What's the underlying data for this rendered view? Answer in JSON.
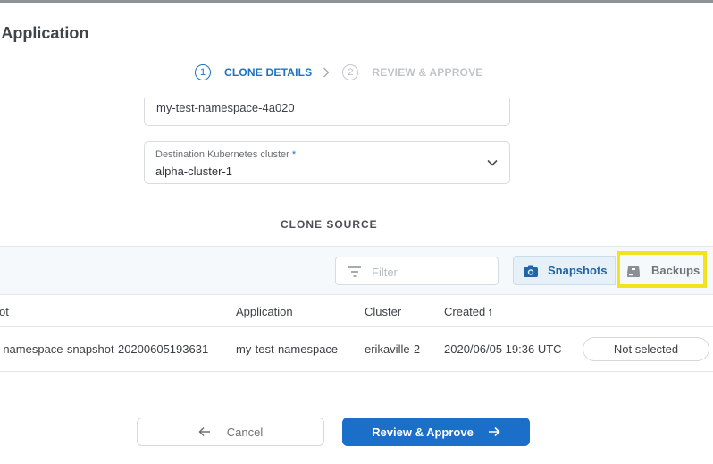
{
  "page": {
    "title": "e Application"
  },
  "stepper": {
    "steps": [
      {
        "number": "1",
        "label": "CLONE DETAILS",
        "active": true
      },
      {
        "number": "2",
        "label": "REVIEW & APPROVE",
        "active": false
      }
    ]
  },
  "form": {
    "namespace_value": "my-test-namespace-4a020",
    "cluster_label": "Destination Kubernetes cluster",
    "cluster_required_mark": "*",
    "cluster_value": "alpha-cluster-1"
  },
  "clone_source": {
    "title": "CLONE SOURCE",
    "filter_placeholder": "Filter",
    "tabs": {
      "snapshots_label": "Snapshots",
      "backups_label": "Backups"
    },
    "columns": [
      "ot",
      "Application",
      "Cluster",
      "Created"
    ],
    "sort_indicator": "↑",
    "rows": [
      {
        "name": "-namespace-snapshot-20200605193631",
        "application": "my-test-namespace",
        "cluster": "erikaville-2",
        "created": "2020/06/05 19:36 UTC",
        "selection": "Not selected"
      }
    ]
  },
  "actions": {
    "cancel_label": "Cancel",
    "approve_label": "Review & Approve"
  },
  "colors": {
    "accent": "#1e73be",
    "primary_button": "#1b6fc8",
    "highlight": "#f1e31c"
  },
  "icons": {
    "filter": "filter-icon",
    "snapshots": "camera-icon",
    "backups": "backup-drive-icon",
    "cancel": "arrow-left-icon",
    "approve": "arrow-right-icon",
    "dropdown": "chevron-down-icon",
    "step_separator": "chevron-right-icon"
  }
}
